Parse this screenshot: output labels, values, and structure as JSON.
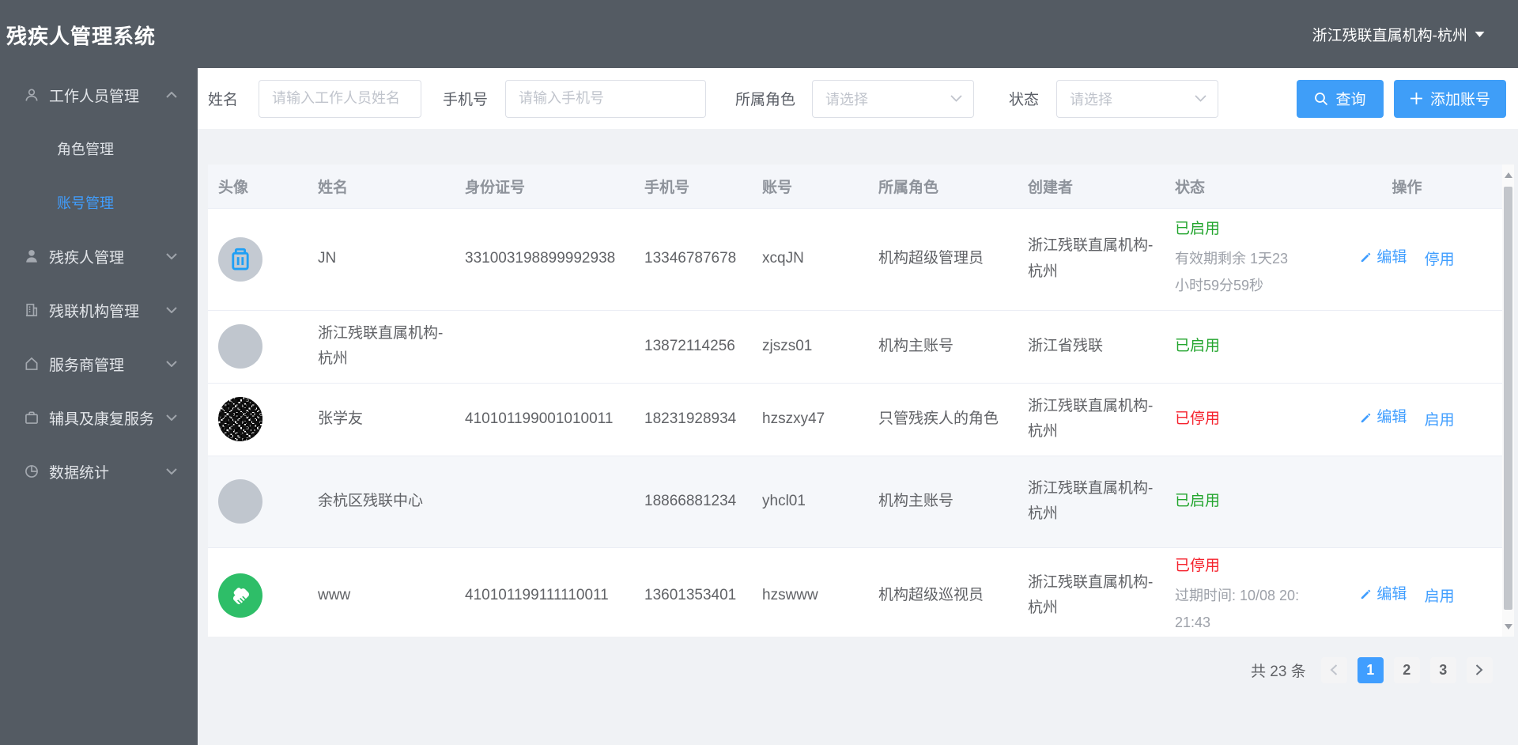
{
  "app": {
    "title": "残疾人管理系统",
    "org_switcher": {
      "label": "浙江残联直属机构-杭州",
      "icon": "caret-down-icon"
    }
  },
  "sidebar": {
    "items": [
      {
        "label": "工作人员管理",
        "icon": "user-outline-icon",
        "state": "expanded",
        "children": [
          {
            "label": "角色管理",
            "active": false
          },
          {
            "label": "账号管理",
            "active": true
          }
        ]
      },
      {
        "label": "残疾人管理",
        "icon": "user-solid-icon",
        "state": "collapsed"
      },
      {
        "label": "残联机构管理",
        "icon": "building-icon",
        "state": "collapsed"
      },
      {
        "label": "服务商管理",
        "icon": "home-icon",
        "state": "collapsed"
      },
      {
        "label": "辅具及康复服务",
        "icon": "briefcase-icon",
        "state": "collapsed"
      },
      {
        "label": "数据统计",
        "icon": "pie-chart-icon",
        "state": "collapsed"
      }
    ]
  },
  "filters": {
    "name": {
      "label": "姓名",
      "placeholder": "请输入工作人员姓名",
      "value": ""
    },
    "phone": {
      "label": "手机号",
      "placeholder": "请输入手机号",
      "value": ""
    },
    "role": {
      "label": "所属角色",
      "placeholder": "请选择",
      "icon": "chevron-down-icon"
    },
    "status": {
      "label": "状态",
      "placeholder": "请选择",
      "icon": "chevron-down-icon"
    },
    "search_button": {
      "label": "查询",
      "icon": "search-icon"
    },
    "add_button": {
      "label": "添加账号",
      "icon": "plus-icon"
    }
  },
  "table": {
    "columns": [
      "头像",
      "姓名",
      "身份证号",
      "手机号",
      "账号",
      "所属角色",
      "创建者",
      "状态",
      "操作"
    ],
    "rows": [
      {
        "avatar": "trash-avatar",
        "name": "JN",
        "id_number": "331003198899992938",
        "phone": "13346787678",
        "account": "xcqJN",
        "role": "机构超级管理员",
        "creator": "浙江残联直属机构-杭州",
        "status": {
          "label": "已启用",
          "type": "enabled",
          "note": "有效期剩余 1天23小时59分59秒"
        },
        "actions": [
          {
            "label": "编辑",
            "icon": "edit-pencil-icon"
          },
          {
            "label": "停用"
          }
        ]
      },
      {
        "avatar": "plain-avatar",
        "name": "浙江残联直属机构-杭州",
        "id_number": "",
        "phone": "13872114256",
        "account": "zjszs01",
        "role": "机构主账号",
        "creator": "浙江省残联",
        "status": {
          "label": "已启用",
          "type": "enabled",
          "note": ""
        },
        "actions": []
      },
      {
        "avatar": "qr-code-avatar",
        "name": "张学友",
        "id_number": "410101199001010011",
        "phone": "18231928934",
        "account": "hzszxy47",
        "role": "只管残疾人的角色",
        "creator": "浙江残联直属机构-杭州",
        "status": {
          "label": "已停用",
          "type": "disabled",
          "note": ""
        },
        "actions": [
          {
            "label": "编辑",
            "icon": "edit-pencil-icon"
          },
          {
            "label": "启用"
          }
        ]
      },
      {
        "avatar": "plain-avatar",
        "name": "余杭区残联中心",
        "id_number": "",
        "phone": "18866881234",
        "account": "yhcl01",
        "role": "机构主账号",
        "creator": "浙江残联直属机构-杭州",
        "status": {
          "label": "已启用",
          "type": "enabled",
          "note": ""
        },
        "actions": []
      },
      {
        "avatar": "handshake-avatar",
        "name": "www",
        "id_number": "410101199111110011",
        "phone": "13601353401",
        "account": "hzswww",
        "role": "机构超级巡视员",
        "creator": "浙江残联直属机构-杭州",
        "status": {
          "label": "已停用",
          "type": "disabled",
          "note": "过期时间: 10/08 20:21:43"
        },
        "actions": [
          {
            "label": "编辑",
            "icon": "edit-pencil-icon"
          },
          {
            "label": "启用"
          }
        ]
      }
    ]
  },
  "pagination": {
    "total": "共 23 条",
    "pages": [
      "1",
      "2",
      "3"
    ],
    "active_page": "1"
  },
  "colors": {
    "accent": "#409EFF",
    "enabled_green": "#23A52E",
    "disabled_red": "#F5222D",
    "sidebar_bg": "#545B63",
    "page_bg": "#F0F2F5"
  }
}
